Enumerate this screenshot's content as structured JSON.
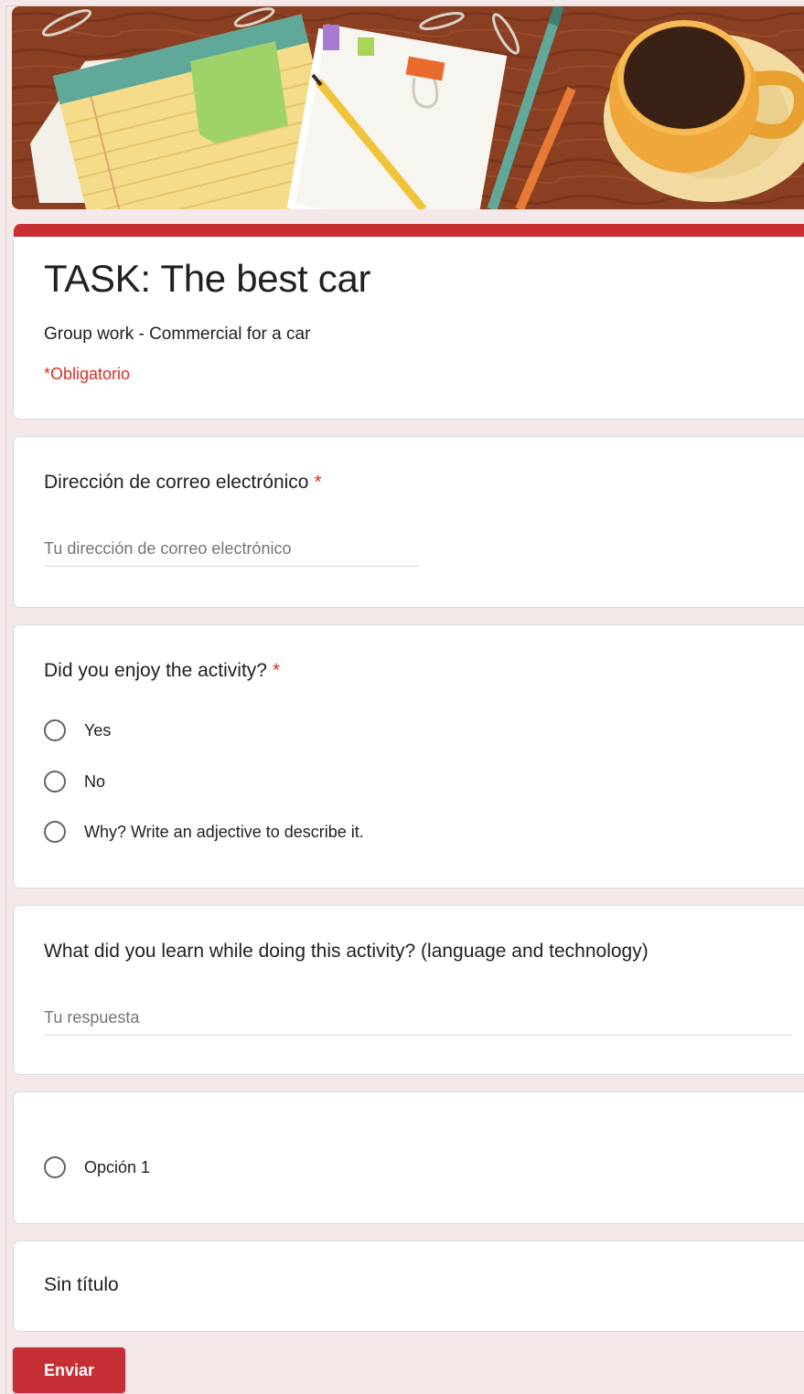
{
  "colors": {
    "accent": "#c62f33",
    "required": "#d93025",
    "page_background": "#f4e8e8"
  },
  "header": {
    "image_description_icon": "desk-illustration-icon"
  },
  "form": {
    "title": "TASK: The best car",
    "description": "Group work - Commercial for a car",
    "required_note": "*Obligatorio"
  },
  "questions": [
    {
      "title": "Dirección de correo electrónico",
      "required_mark": "*",
      "type": "short-text",
      "placeholder": "Tu dirección de correo electrónico"
    },
    {
      "title": "Did you enjoy the activity?",
      "required_mark": "*",
      "type": "radio",
      "options": [
        "Yes",
        "No",
        "Why? Write an adjective to describe it."
      ]
    },
    {
      "title": "What did you learn while doing this activity? (language and technology)",
      "type": "short-text",
      "placeholder": "Tu respuesta"
    },
    {
      "title": "",
      "type": "radio",
      "options": [
        "Opción 1"
      ]
    },
    {
      "title": "Sin título",
      "type": "section"
    }
  ],
  "submit_label": "Enviar"
}
